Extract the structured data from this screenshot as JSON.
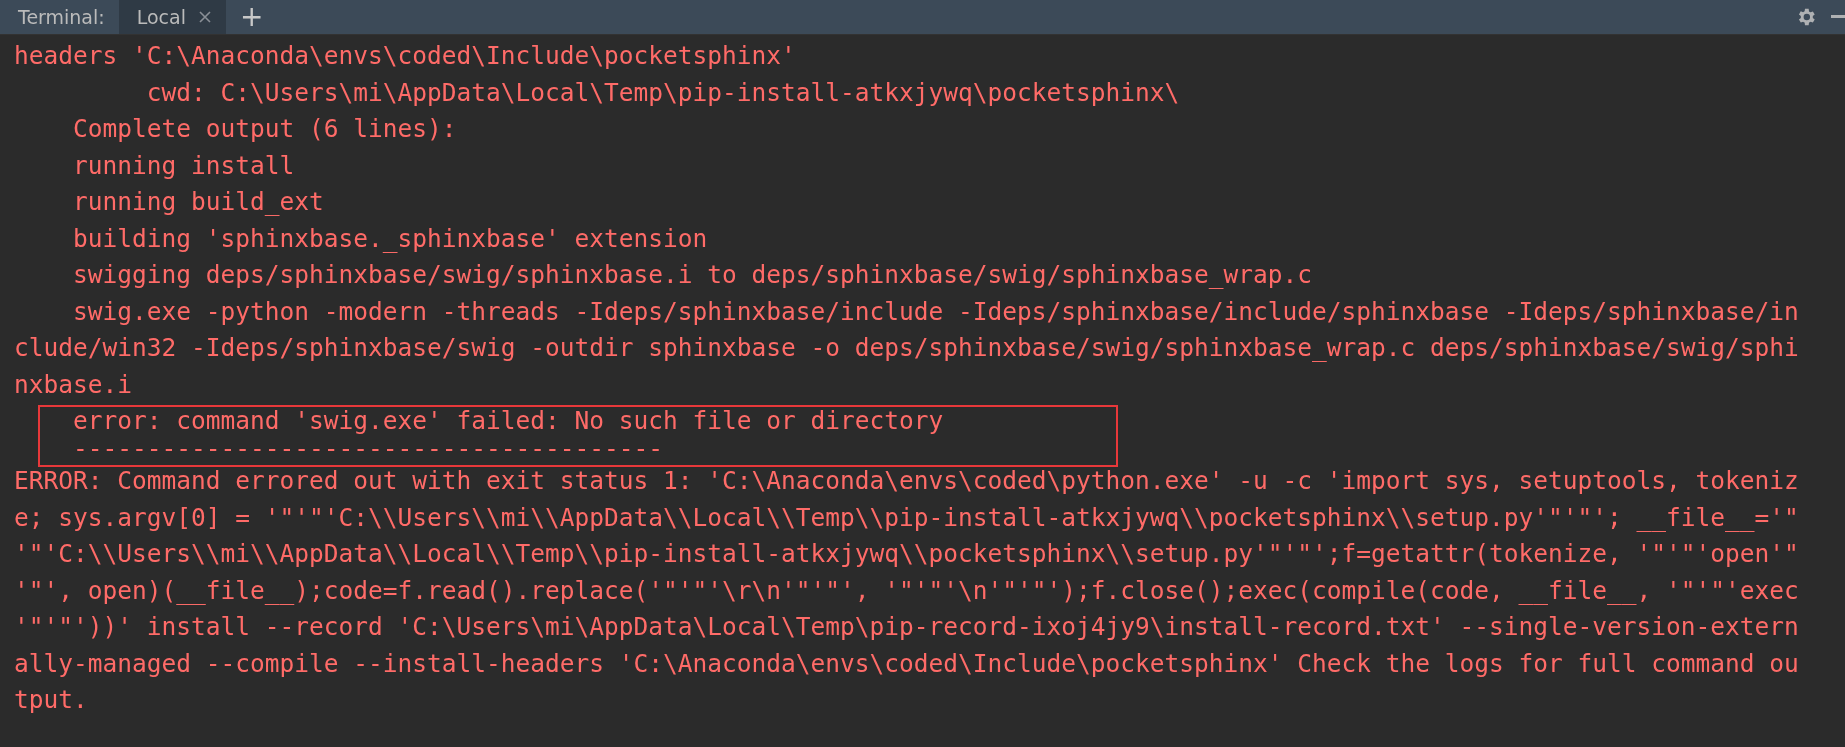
{
  "toolbar": {
    "title": "Terminal:",
    "tabs": [
      {
        "label": "Local",
        "selected": true,
        "closable": true
      }
    ],
    "add_button": "+"
  },
  "lines": [
    {
      "text": "headers 'C:\\Anaconda\\envs\\coded\\Include\\pocketsphinx'",
      "highlighted": false
    },
    {
      "text": "         cwd: C:\\Users\\mi\\AppData\\Local\\Temp\\pip-install-atkxjywq\\pocketsphinx\\",
      "highlighted": false
    },
    {
      "text": "    Complete output (6 lines):",
      "highlighted": false
    },
    {
      "text": "    running install",
      "highlighted": false
    },
    {
      "text": "    running build_ext",
      "highlighted": false
    },
    {
      "text": "    building 'sphinxbase._sphinxbase' extension",
      "highlighted": false
    },
    {
      "text": "    swigging deps/sphinxbase/swig/sphinxbase.i to deps/sphinxbase/swig/sphinxbase_wrap.c",
      "highlighted": false
    },
    {
      "text": "    swig.exe -python -modern -threads -Ideps/sphinxbase/include -Ideps/sphinxbase/include/sphinxbase -Ideps/sphinxbase/in",
      "highlighted": false
    },
    {
      "text": "clude/win32 -Ideps/sphinxbase/swig -outdir sphinxbase -o deps/sphinxbase/swig/sphinxbase_wrap.c deps/sphinxbase/swig/sphi",
      "highlighted": false
    },
    {
      "text": "nxbase.i",
      "highlighted": false
    },
    {
      "text": "    error: command 'swig.exe' failed: No such file or directory",
      "highlighted": true
    },
    {
      "text": "    ----------------------------------------",
      "highlighted": true
    },
    {
      "text": "ERROR: Command errored out with exit status 1: 'C:\\Anaconda\\envs\\coded\\python.exe' -u -c 'import sys, setuptools, tokeniz",
      "highlighted": false
    },
    {
      "text": "e; sys.argv[0] = '\"'\"'C:\\\\Users\\\\mi\\\\AppData\\\\Local\\\\Temp\\\\pip-install-atkxjywq\\\\pocketsphinx\\\\setup.py'\"'\"'; __file__='\"",
      "highlighted": false
    },
    {
      "text": "'\"'C:\\\\Users\\\\mi\\\\AppData\\\\Local\\\\Temp\\\\pip-install-atkxjywq\\\\pocketsphinx\\\\setup.py'\"'\"';f=getattr(tokenize, '\"'\"'open'\"",
      "highlighted": false
    },
    {
      "text": "'\"', open)(__file__);code=f.read().replace('\"'\"'\\r\\n'\"'\"', '\"'\"'\\n'\"'\"');f.close();exec(compile(code, __file__, '\"'\"'exec",
      "highlighted": false
    },
    {
      "text": "'\"'\"'))' install --record 'C:\\Users\\mi\\AppData\\Local\\Temp\\pip-record-ixoj4jy9\\install-record.txt' --single-version-extern",
      "highlighted": false
    },
    {
      "text": "ally-managed --compile --install-headers 'C:\\Anaconda\\envs\\coded\\Include\\pocketsphinx' Check the logs for full command ou",
      "highlighted": false
    },
    {
      "text": "tput.",
      "highlighted": false
    }
  ]
}
